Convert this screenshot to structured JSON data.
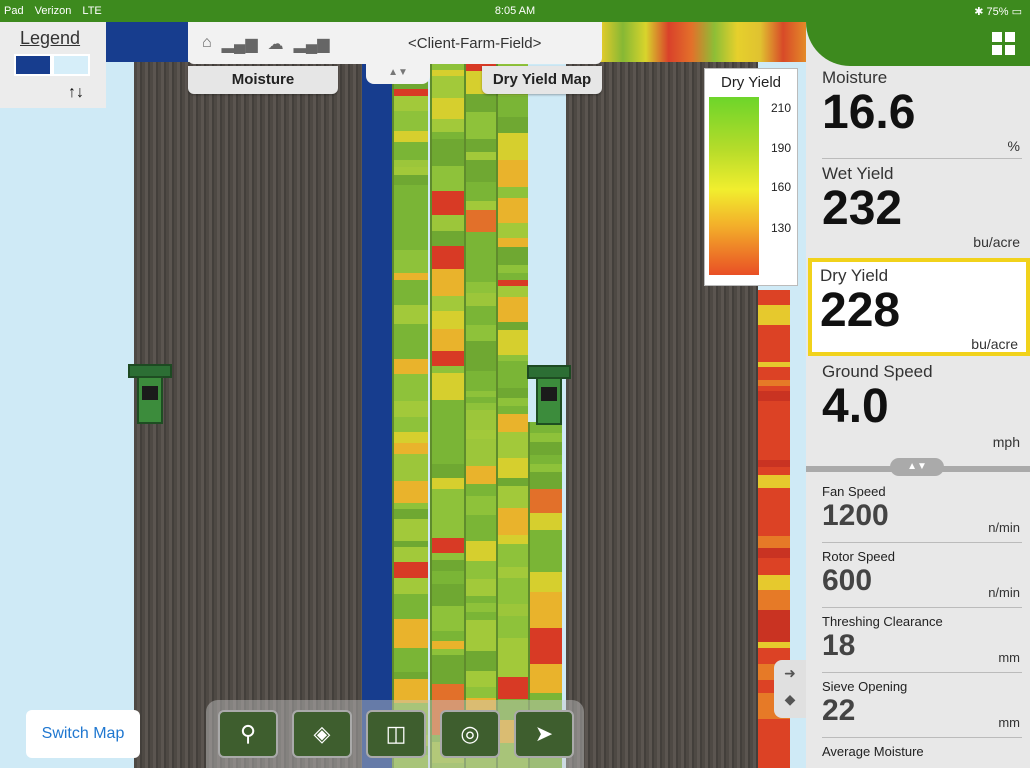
{
  "status_bar": {
    "device": "Pad",
    "carrier": "Verizon",
    "network": "LTE",
    "time": "8:05 AM",
    "bluetooth": "bluetooth-icon",
    "battery": "75%"
  },
  "legend": {
    "title": "Legend",
    "arrows": "↑↓",
    "colors": [
      "#173d8e",
      "#d6eef9"
    ]
  },
  "header": {
    "title": "<Client-Farm-Field>",
    "icons": [
      "wifi-icon",
      "signal-icon",
      "cloud-icon",
      "signal-icon"
    ]
  },
  "map_tabs": {
    "left": "Moisture",
    "right": "Dry Yield Map"
  },
  "dry_yield_legend": {
    "title": "Dry Yield",
    "ticks": [
      "210",
      "190",
      "160",
      "130"
    ],
    "colors": [
      "#6dd52a",
      "#f1ee2e",
      "#e94f25"
    ]
  },
  "panel": {
    "moisture": {
      "label": "Moisture",
      "value": "16.6",
      "unit": "%"
    },
    "wet_yield": {
      "label": "Wet Yield",
      "value": "232",
      "unit": "bu/acre"
    },
    "dry_yield": {
      "label": "Dry Yield",
      "value": "228",
      "unit": "bu/acre"
    },
    "ground_speed": {
      "label": "Ground Speed",
      "value": "4.0",
      "unit": "mph"
    },
    "fan_speed": {
      "label": "Fan Speed",
      "value": "1200",
      "unit": "n/min"
    },
    "rotor_speed": {
      "label": "Rotor Speed",
      "value": "600",
      "unit": "n/min"
    },
    "threshing_clearance": {
      "label": "Threshing Clearance",
      "value": "18",
      "unit": "mm"
    },
    "sieve_opening": {
      "label": "Sieve Opening",
      "value": "22",
      "unit": "mm"
    },
    "average_moisture": {
      "label": "Average Moisture"
    }
  },
  "switch_map": "Switch Map",
  "toolbar": [
    "location-pin-icon",
    "layers-icon",
    "split-view-icon",
    "target-icon",
    "navigate-arrow-icon"
  ]
}
